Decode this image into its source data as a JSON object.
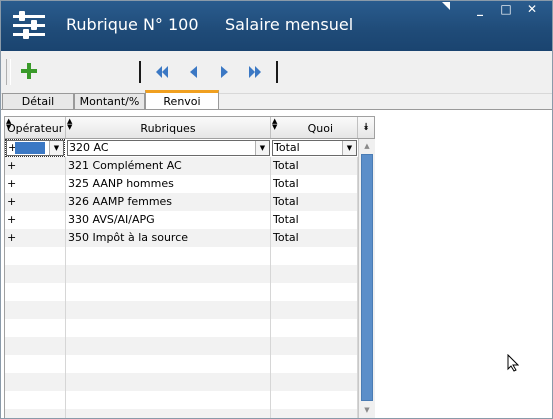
{
  "window": {
    "title_number": "Rubrique N° 100",
    "title_name": "Salaire mensuel",
    "controls": [
      "_",
      "□",
      "✕"
    ]
  },
  "toolbar": {
    "add_icon": "plus-icon",
    "nav_icons": [
      "first-icon",
      "previous-icon",
      "next-icon",
      "last-icon"
    ],
    "add_color": "#3a9a2a",
    "nav_color": "#3b78c4"
  },
  "tabs": [
    {
      "label": "Détail",
      "active": false
    },
    {
      "label": "Montant/%",
      "active": false
    },
    {
      "label": "Renvoi",
      "active": true
    }
  ],
  "grid": {
    "headers": {
      "operateur": "Opérateur",
      "rubriques": "Rubriques",
      "quoi": "Quoi",
      "menu": "⯯"
    },
    "rows": [
      {
        "operateur": "+",
        "rubrique": "320 AC",
        "quoi": "Total"
      },
      {
        "operateur": "+",
        "rubrique": "321 Complément AC",
        "quoi": "Total"
      },
      {
        "operateur": "+",
        "rubrique": "325 AANP hommes",
        "quoi": "Total"
      },
      {
        "operateur": "+",
        "rubrique": "326 AAMP femmes",
        "quoi": "Total"
      },
      {
        "operateur": "+",
        "rubrique": "330 AVS/AI/APG",
        "quoi": "Total"
      },
      {
        "operateur": "+",
        "rubrique": "350 Impôt à la source",
        "quoi": "Total"
      }
    ]
  },
  "colors": {
    "titlebar": "#1f4b78",
    "tab_accent": "#f0a020",
    "scroll_thumb": "#5b8ec9",
    "selection": "#3b78c4"
  }
}
